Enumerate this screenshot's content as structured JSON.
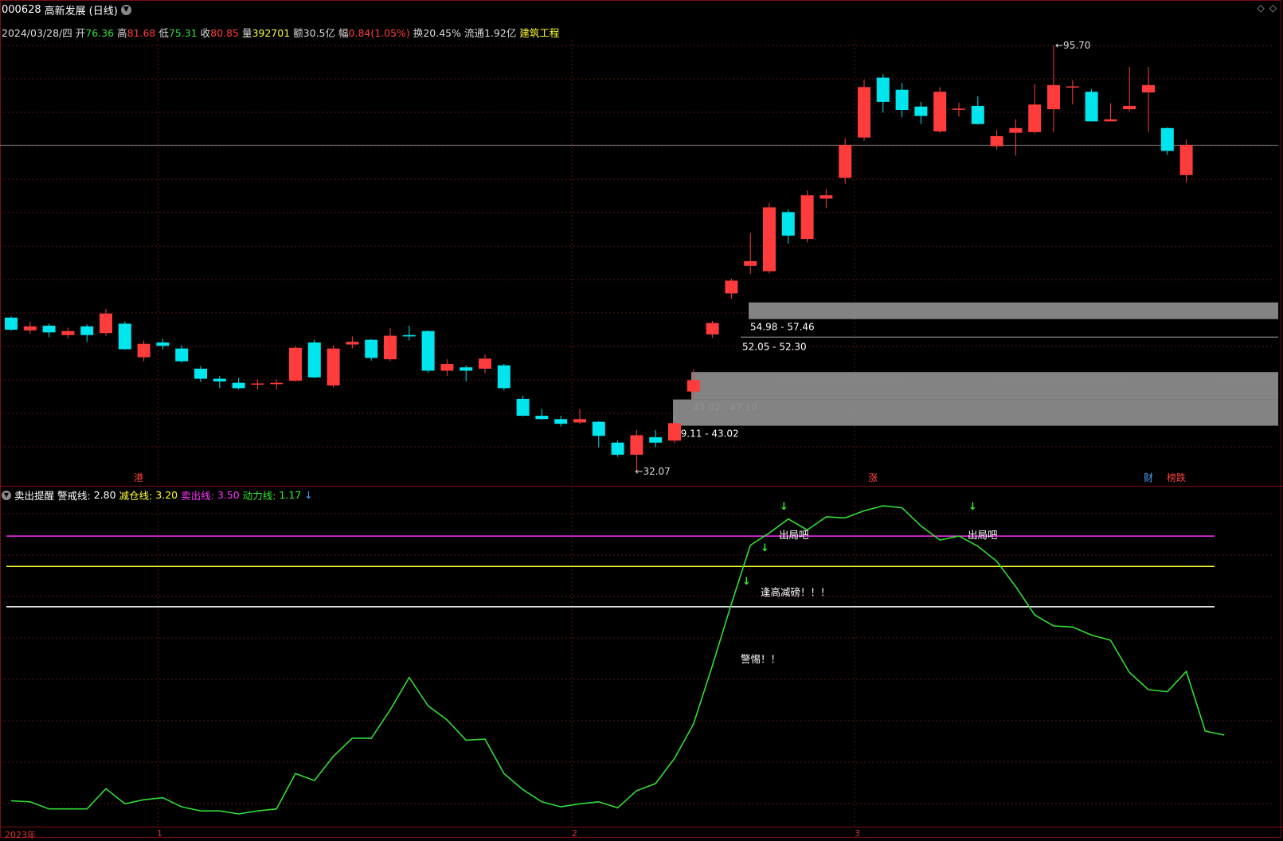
{
  "title": {
    "code": "000628",
    "name": "高新发展",
    "period": "(日线)"
  },
  "window_controls": {
    "restore": "◇",
    "close": "◇"
  },
  "info_bar": {
    "date": "2024/03/28/四",
    "open_label": "开",
    "open": "76.36",
    "high_label": "高",
    "high": "81.68",
    "low_label": "低",
    "low": "75.31",
    "close_label": "收",
    "close": "80.85",
    "volume_label": "量",
    "volume": "392701",
    "amount_label": "额",
    "amount": "30.5亿",
    "change_label": "幅",
    "change": "0.84(1.05%)",
    "turnover_label": "换",
    "turnover": "20.45%",
    "float_label": "流通",
    "float": "1.92亿",
    "sector": "建筑工程"
  },
  "price_annotations": {
    "high_mark": "95.70",
    "low_mark": "32.07"
  },
  "zones": [
    {
      "label": "54.98 - 57.46"
    },
    {
      "label": "52.05 - 52.30"
    },
    {
      "label": "43.02 - 47.10"
    },
    {
      "label": "39.11 - 43.02"
    }
  ],
  "event_tags": [
    {
      "text": "港",
      "color": "#ff4040"
    },
    {
      "text": "涨",
      "color": "#ff4040"
    },
    {
      "text": "财",
      "color": "#4aa3ff"
    },
    {
      "text": "榜跌",
      "color": "#ff4040"
    }
  ],
  "indicator": {
    "name": "卖出提醒",
    "lines": [
      {
        "label": "警戒线:",
        "value": "2.80",
        "color": "#ffffff"
      },
      {
        "label": "减仓线:",
        "value": "3.20",
        "color": "#ffff33"
      },
      {
        "label": "卖出线:",
        "value": "3.50",
        "color": "#ff33ff"
      },
      {
        "label": "动力线:",
        "value": "1.17",
        "color": "#33ee33"
      }
    ],
    "down_arrow": "↓",
    "annotations": [
      "出局吧",
      "出局吧",
      "逢高减磅！！！",
      "警惕！！"
    ]
  },
  "x_axis": [
    "2023年",
    "1",
    "2",
    "3"
  ],
  "colors": {
    "up": "#ff3c3c",
    "down": "#00e5ee",
    "line": "#33dd33"
  },
  "chart_data": {
    "type": "candlestick",
    "series": [
      {
        "name": "k",
        "ohlc": [
          [
            55.2,
            53.4,
            55.4,
            53.2
          ],
          [
            53.3,
            53.9,
            54.6,
            52.8
          ],
          [
            54.0,
            53.0,
            54.3,
            52.3
          ],
          [
            52.6,
            53.2,
            53.7,
            52.1
          ],
          [
            53.9,
            52.6,
            54.2,
            51.6
          ],
          [
            52.9,
            55.8,
            56.5,
            52.5
          ],
          [
            54.3,
            50.5,
            54.6,
            50.4
          ],
          [
            49.3,
            51.3,
            51.8,
            48.7
          ],
          [
            51.5,
            51.0,
            52.0,
            50.5
          ],
          [
            50.6,
            48.7,
            51.1,
            48.5
          ],
          [
            47.6,
            46.1,
            48.0,
            45.6
          ],
          [
            46.1,
            45.7,
            46.5,
            44.7
          ],
          [
            45.5,
            44.7,
            46.2,
            44.5
          ],
          [
            45.3,
            45.4,
            46.0,
            44.5
          ],
          [
            45.3,
            45.5,
            46.0,
            44.5
          ],
          [
            45.8,
            50.7,
            51.0,
            45.7
          ],
          [
            51.5,
            46.3,
            51.9,
            46.2
          ],
          [
            45.1,
            50.6,
            51.1,
            44.8
          ],
          [
            51.2,
            51.6,
            52.4,
            50.6
          ],
          [
            51.9,
            49.2,
            52.0,
            48.8
          ],
          [
            49.0,
            52.5,
            53.6,
            48.7
          ],
          [
            52.6,
            52.4,
            54.0,
            51.8
          ],
          [
            53.2,
            47.3,
            53.3,
            47.0
          ],
          [
            47.3,
            48.3,
            49.0,
            46.5
          ],
          [
            47.8,
            47.3,
            48.1,
            45.7
          ],
          [
            47.6,
            49.1,
            49.7,
            46.9
          ],
          [
            48.1,
            44.7,
            48.3,
            44.4
          ],
          [
            43.1,
            40.6,
            43.6,
            40.5
          ],
          [
            40.6,
            40.1,
            41.6,
            40.0
          ],
          [
            40.1,
            39.4,
            40.6,
            39.0
          ],
          [
            39.6,
            40.1,
            41.6,
            39.4
          ],
          [
            39.7,
            37.6,
            39.8,
            35.9
          ],
          [
            36.6,
            34.8,
            36.9,
            34.5
          ],
          [
            34.8,
            37.7,
            38.5,
            32.1
          ],
          [
            37.4,
            36.6,
            38.5,
            35.9
          ],
          [
            36.9,
            39.5,
            39.6,
            36.5
          ],
          [
            44.2,
            45.9,
            47.5,
            43.3
          ],
          [
            52.7,
            54.4,
            54.7,
            52.2
          ],
          [
            58.8,
            60.7,
            61.0,
            58.0
          ],
          [
            62.9,
            63.6,
            67.8,
            61.7
          ],
          [
            62.1,
            71.6,
            72.3,
            61.8
          ],
          [
            70.9,
            67.4,
            71.3,
            66.2
          ],
          [
            66.9,
            73.4,
            74.1,
            66.4
          ],
          [
            72.9,
            73.4,
            74.3,
            71.5
          ],
          [
            76.0,
            80.9,
            81.9,
            75.1
          ],
          [
            82.0,
            89.5,
            90.6,
            81.5
          ],
          [
            90.9,
            87.3,
            91.4,
            85.7
          ],
          [
            89.1,
            86.1,
            90.1,
            85.0
          ],
          [
            86.6,
            85.2,
            87.3,
            84.0
          ],
          [
            82.9,
            88.8,
            89.5,
            82.7
          ],
          [
            86.2,
            86.3,
            87.2,
            85.1
          ],
          [
            86.7,
            84.0,
            88.1,
            83.9
          ],
          [
            80.7,
            82.2,
            83.1,
            80.2
          ],
          [
            82.7,
            83.4,
            84.7,
            79.3
          ],
          [
            82.8,
            86.9,
            90.0,
            82.6
          ],
          [
            86.2,
            89.8,
            95.7,
            82.8
          ],
          [
            89.6,
            89.6,
            90.5,
            86.9
          ],
          [
            88.8,
            84.4,
            89.2,
            84.4
          ],
          [
            84.4,
            84.7,
            87.1,
            84.4
          ],
          [
            86.2,
            86.7,
            92.5,
            85.9
          ],
          [
            88.7,
            89.8,
            92.5,
            82.8
          ],
          [
            83.4,
            80.0,
            83.5,
            79.4
          ],
          [
            76.4,
            80.9,
            81.7,
            75.3
          ]
        ]
      }
    ],
    "indicator_values": [
      0.88,
      0.87,
      0.8,
      0.8,
      0.8,
      1.0,
      0.85,
      0.89,
      0.91,
      0.82,
      0.78,
      0.78,
      0.75,
      0.78,
      0.8,
      1.15,
      1.08,
      1.32,
      1.5,
      1.5,
      1.78,
      2.1,
      1.82,
      1.68,
      1.48,
      1.49,
      1.15,
      0.99,
      0.87,
      0.82,
      0.85,
      0.87,
      0.81,
      0.98,
      1.05,
      1.3,
      1.64,
      2.22,
      2.83,
      3.41,
      3.53,
      3.67,
      3.56,
      3.69,
      3.68,
      3.75,
      3.8,
      3.78,
      3.6,
      3.46,
      3.5,
      3.4,
      3.25,
      3.0,
      2.72,
      2.61,
      2.6,
      2.52,
      2.47,
      2.15,
      1.98,
      1.96,
      2.16,
      1.57,
      1.53
    ],
    "levels": {
      "警戒线": 2.8,
      "减仓线": 3.2,
      "卖出线": 3.5
    }
  }
}
